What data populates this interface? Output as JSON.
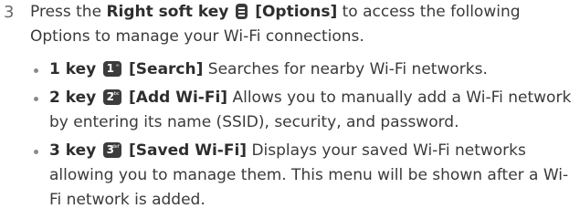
{
  "step": {
    "number": "3",
    "text_before": "Press the ",
    "key_label": "Right soft key",
    "key_icon": "right-soft-key-icon",
    "options_label": "[Options]",
    "text_after": " to access the following Options to manage your Wi-Fi connections."
  },
  "items": [
    {
      "key_label": "1 key",
      "icon_digit": "1",
      "icon_sub": "∞",
      "name": "[Search]",
      "description": " Searches for nearby Wi-Fi networks."
    },
    {
      "key_label": "2 key",
      "icon_digit": "2",
      "icon_sub": "abc",
      "name": "[Add Wi-Fi]",
      "description": " Allows you to manually add a Wi-Fi network by entering its name (SSID), security, and password."
    },
    {
      "key_label": "3 key",
      "icon_digit": "3",
      "icon_sub": "def",
      "name": "[Saved Wi-Fi]",
      "description": " Displays your saved Wi-Fi networks allowing you to manage them. This menu will be shown after a Wi-Fi network is added."
    }
  ]
}
